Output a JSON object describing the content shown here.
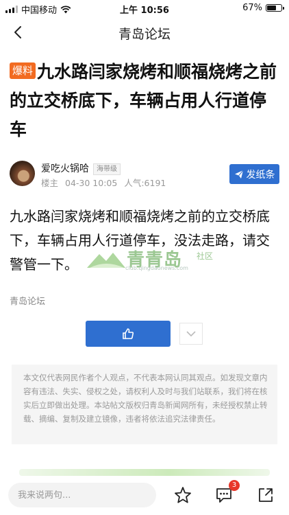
{
  "status_bar": {
    "carrier": "中国移动",
    "time": "上午 10:56",
    "battery_percent": "67%",
    "battery_level": 0.67
  },
  "nav": {
    "title": "青岛论坛"
  },
  "post": {
    "tag": "爆料",
    "title": "九水路闫家烧烤和顺福烧烤之前的立交桥底下，车辆占用人行道停车",
    "author": "爱吃火锅哈",
    "author_level": "海带级",
    "floor": "楼主",
    "date": "04-30 10:05",
    "views": "人气:6191",
    "body": "九水路闫家烧烤和顺福烧烤之前的立交桥底下，车辆占用人行道停车，没法走路，请交警管一下。",
    "source": "青岛论坛"
  },
  "actions": {
    "post_button": "发纸条",
    "like_icon": "thumbs-up-icon",
    "dislike_icon": "chevron-down-icon"
  },
  "watermark": {
    "brand": "青青岛",
    "sub": "社区",
    "url": "club.qingdaonews.com"
  },
  "disclaimer": "本文仅代表网民作者个人观点，不代表本网认同其观点。如发现文章内容有违法、失实、侵权之处，请权利人及时与我们站联系，我们将在核实后立即做出处理。本站帖文版权归青岛新闻网所有，未经授权禁止转载、摘编、复制及建立镜像，违者将依法追究法律责任。",
  "bottom_bar": {
    "comment_placeholder": "我来说两句...",
    "comment_count": "3"
  },
  "colors": {
    "accent": "#2f6fd0",
    "tag": "#f26b21",
    "badge": "#e8382b"
  }
}
